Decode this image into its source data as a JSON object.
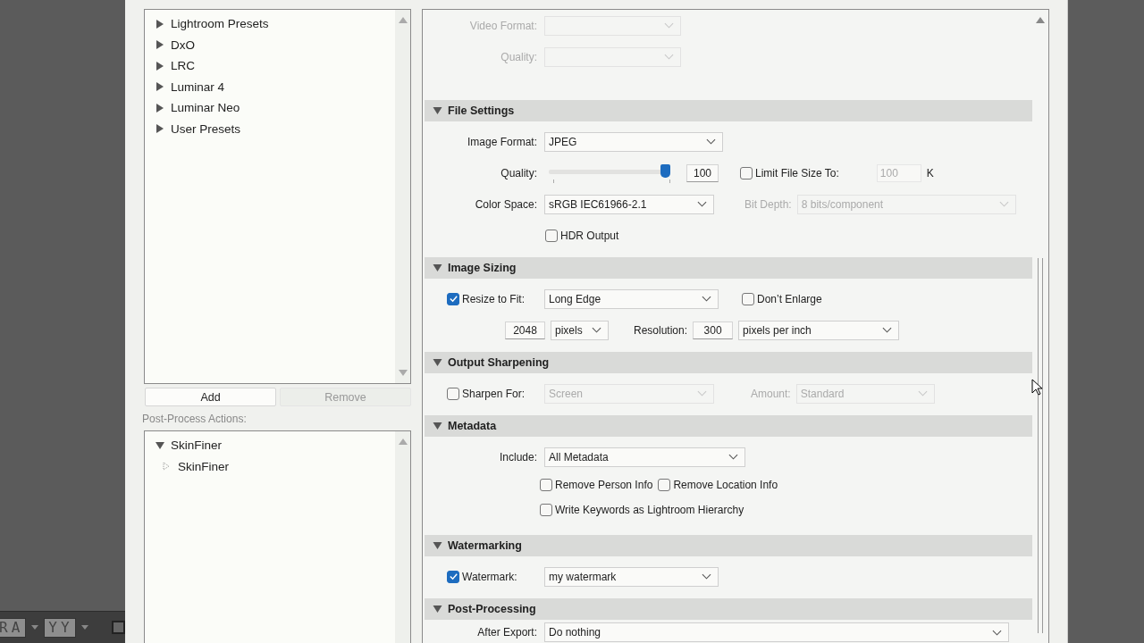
{
  "toolbar": {
    "buttons": [
      {
        "label": "RA"
      },
      {
        "label": "YY"
      }
    ]
  },
  "presets": {
    "items": [
      {
        "label": "Lightroom Presets",
        "expanded": false
      },
      {
        "label": "DxO",
        "expanded": false
      },
      {
        "label": "LRC",
        "expanded": false
      },
      {
        "label": "Luminar 4",
        "expanded": false
      },
      {
        "label": "Luminar Neo",
        "expanded": false
      },
      {
        "label": "User Presets",
        "expanded": false
      }
    ]
  },
  "preset_buttons": [
    {
      "label": "Add",
      "disabled": false
    },
    {
      "label": "Remove",
      "disabled": true
    }
  ],
  "post_process": {
    "label": "Post-Process Actions:",
    "items": [
      {
        "label": "SkinFiner",
        "expanded": true,
        "children": [
          {
            "label": "SkinFiner"
          }
        ]
      }
    ]
  },
  "sections": [
    {
      "rows": [
        {
          "label": "Video Format:",
          "disabled": true,
          "items": [
            {
              "kind": "select",
              "value": "",
              "disabled": true
            }
          ]
        },
        {
          "label": "Quality:",
          "disabled": true,
          "items": [
            {
              "kind": "select",
              "value": "",
              "disabled": true
            }
          ]
        }
      ]
    },
    {
      "title": "File Settings",
      "expanded": true,
      "rows": [
        {
          "label": "Image Format:",
          "disabled": false,
          "items": [
            {
              "kind": "select",
              "value": "JPEG",
              "disabled": false
            }
          ]
        },
        {
          "label": "Quality:",
          "disabled": false,
          "items": [
            {
              "kind": "slider",
              "level": 1.0
            },
            {
              "kind": "input",
              "value": "100",
              "disabled": false
            },
            {
              "kind": "checkbox",
              "label": "Limit File Size To:",
              "checked": false
            },
            {
              "kind": "input",
              "value": "100",
              "disabled": true
            },
            {
              "kind": "unit",
              "text": "K"
            }
          ]
        },
        {
          "label": "Color Space:",
          "disabled": false,
          "items": [
            {
              "kind": "select",
              "value": "sRGB IEC61966-2.1",
              "disabled": false
            },
            {
              "kind": "label",
              "text": "Bit Depth:",
              "disabled": true
            },
            {
              "kind": "select",
              "value": "8 bits/component",
              "disabled": true
            }
          ]
        },
        {
          "items": [
            {
              "kind": "checkbox",
              "label": "HDR Output",
              "checked": false
            }
          ]
        }
      ]
    },
    {
      "title": "Image Sizing",
      "expanded": true,
      "rows": [
        {
          "lead": {
            "label": "Resize to Fit:",
            "checked": true
          },
          "items": [
            {
              "kind": "select",
              "value": "Long Edge",
              "disabled": false
            },
            {
              "kind": "checkbox",
              "label": "Don’t Enlarge",
              "checked": false
            }
          ]
        },
        {
          "items": [
            {
              "kind": "input",
              "value": "2048",
              "disabled": false
            },
            {
              "kind": "select",
              "value": "pixels",
              "disabled": false
            },
            {
              "kind": "label",
              "text": "Resolution:",
              "disabled": false
            },
            {
              "kind": "input",
              "value": "300",
              "disabled": false
            },
            {
              "kind": "select",
              "value": "pixels per inch",
              "disabled": false
            }
          ]
        }
      ]
    },
    {
      "title": "Output Sharpening",
      "expanded": true,
      "rows": [
        {
          "lead": {
            "label": "Sharpen For:",
            "checked": false
          },
          "items": [
            {
              "kind": "select",
              "value": "Screen",
              "disabled": true
            },
            {
              "kind": "label",
              "text": "Amount:",
              "disabled": true
            },
            {
              "kind": "select",
              "value": "Standard",
              "disabled": true
            }
          ]
        }
      ]
    },
    {
      "title": "Metadata",
      "expanded": true,
      "rows": [
        {
          "label": "Include:",
          "disabled": false,
          "items": [
            {
              "kind": "select",
              "value": "All Metadata",
              "disabled": false
            }
          ]
        },
        {
          "items": [
            {
              "kind": "checkbox",
              "label": "Remove Person Info",
              "checked": false
            },
            {
              "kind": "checkbox",
              "label": "Remove Location Info",
              "checked": false
            }
          ]
        },
        {
          "items": [
            {
              "kind": "checkbox",
              "label": "Write Keywords as Lightroom Hierarchy",
              "checked": false
            }
          ]
        }
      ]
    },
    {
      "title": "Watermarking",
      "expanded": true,
      "rows": [
        {
          "lead": {
            "label": "Watermark:",
            "checked": true
          },
          "items": [
            {
              "kind": "select",
              "value": "my watermark",
              "disabled": false
            }
          ]
        }
      ]
    },
    {
      "title": "Post-Processing",
      "expanded": true,
      "rows": [
        {
          "label": "After Export:",
          "disabled": false,
          "items": [
            {
              "kind": "select",
              "value": "Do nothing",
              "disabled": false
            }
          ]
        }
      ]
    }
  ]
}
